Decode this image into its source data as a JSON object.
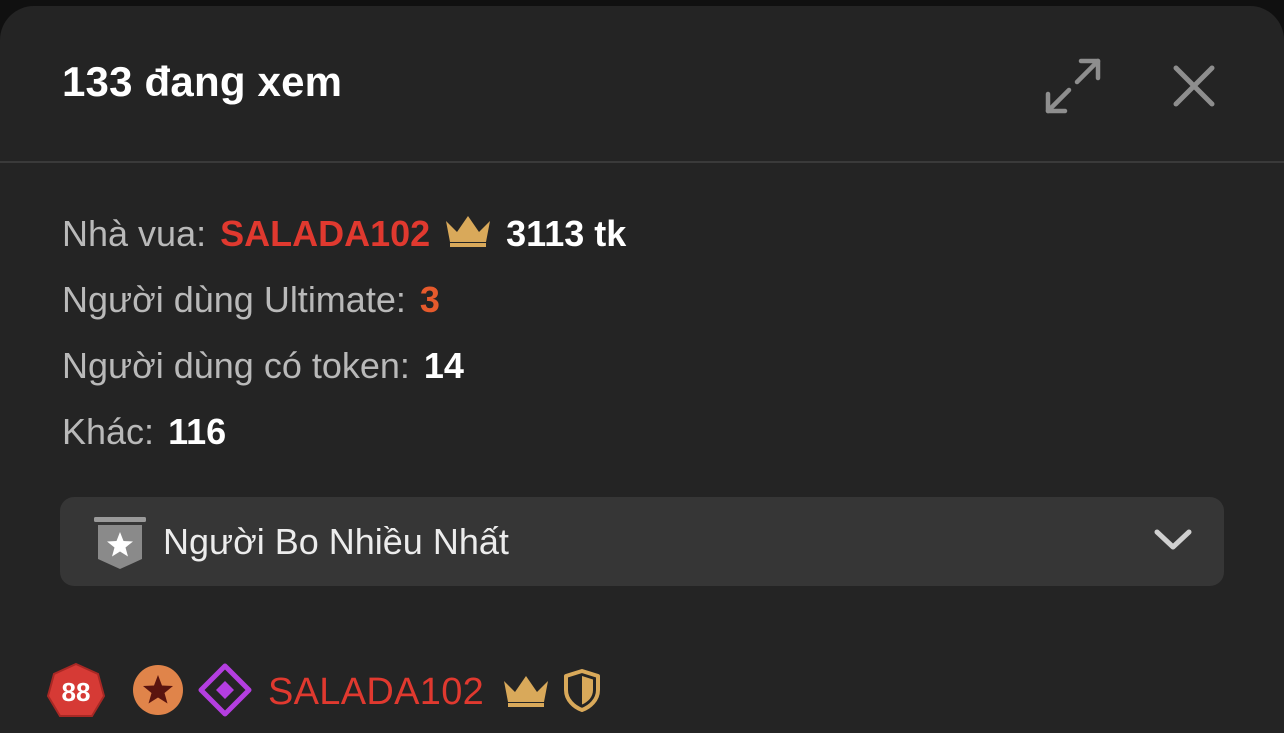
{
  "header": {
    "title": "133 đang xem",
    "expand_icon": "expand-arrows-icon",
    "close_icon": "close-icon"
  },
  "stats": {
    "king_label": "Nhà vua:",
    "king_name": "SALADA102",
    "king_tokens": "3113 tk",
    "ultimate_label": "Người dùng Ultimate:",
    "ultimate_value": "3",
    "token_users_label": "Người dùng có token:",
    "token_users_value": "14",
    "other_label": "Khác:",
    "other_value": "116"
  },
  "dropdown": {
    "label": "Người Bo Nhiều Nhất",
    "icon": "star-badge-icon"
  },
  "user_list": [
    {
      "level": "88",
      "username": "SALADA102",
      "badges": [
        "star-medal-icon",
        "diamond-icon",
        "crown-icon",
        "shield-icon"
      ]
    }
  ],
  "colors": {
    "background": "#242424",
    "king_name": "#e0392f",
    "ultimate_value": "#e65a2c",
    "crown": "#d9a95a",
    "dropdown_bg": "#363636",
    "level_badge": "#d63a35",
    "diamond": "#b43ee0"
  }
}
